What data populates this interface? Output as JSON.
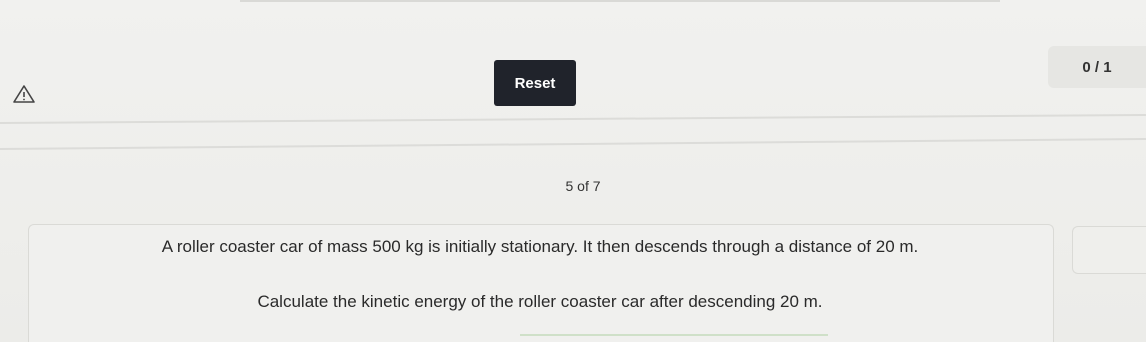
{
  "toolbar": {
    "reset_label": "Reset",
    "score": "0 / 1"
  },
  "icons": {
    "warning": "warning-triangle-icon"
  },
  "progress": {
    "label": "5 of 7"
  },
  "question": {
    "line1": "A roller coaster car of mass 500 kg is initially stationary. It then descends through a distance of 20 m.",
    "line2": "Calculate the kinetic energy of the roller coaster car after descending 20 m."
  }
}
